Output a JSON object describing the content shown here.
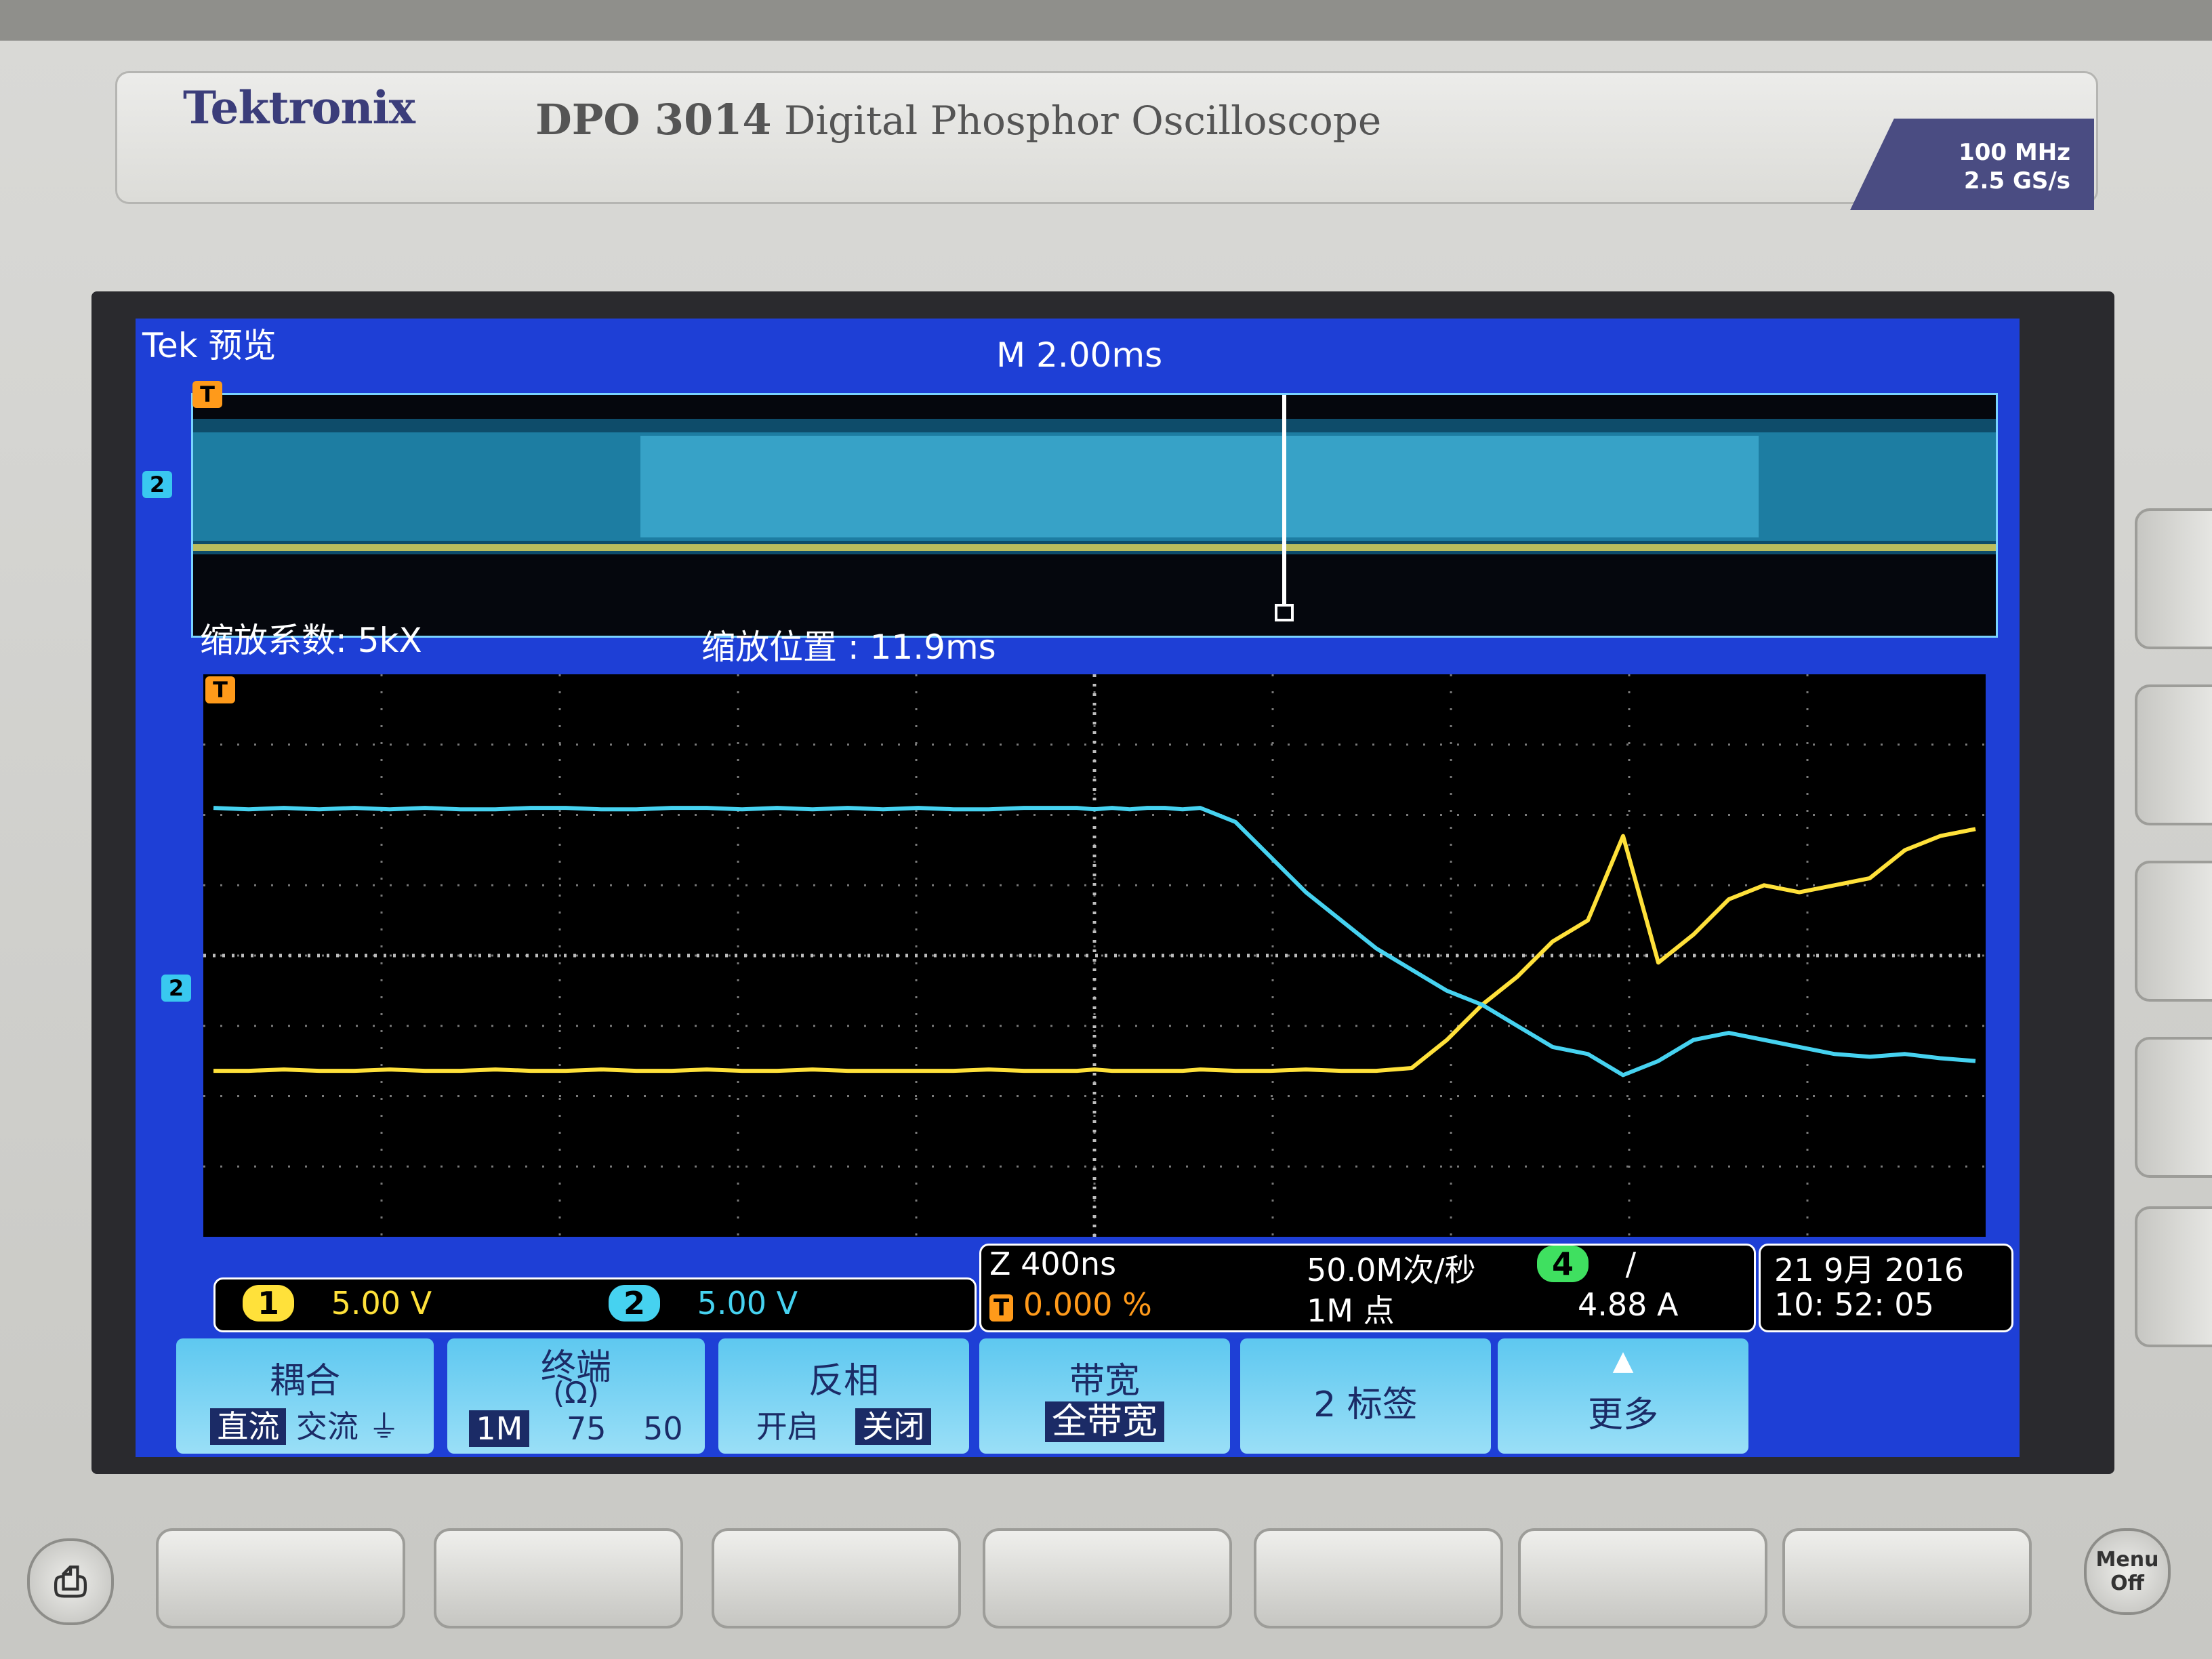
{
  "instrument": {
    "brand": "Tektronix",
    "model": "DPO 3014",
    "description": "Digital Phosphor Oscilloscope",
    "bandwidth": "100 MHz",
    "sample_rate": "2.5 GS/s"
  },
  "screen_header": {
    "brand_mark": "Tek",
    "mode": "预览",
    "timebase": "M 2.00ms"
  },
  "zoom_info": {
    "factor": "缩放系数: 5kX",
    "position": "缩放位置 :  11.9ms"
  },
  "markers": {
    "trigger": "T",
    "ch2": "2"
  },
  "status": {
    "ch1_num": "1",
    "ch1_scale": "5.00 V",
    "ch2_num": "2",
    "ch2_scale": "5.00 V",
    "zoom_timebase": "Z 400ns",
    "trigger_pos": "0.000 %",
    "sample_rate": "50.0M次/秒",
    "record_length": "1M 点",
    "trig_source": "4",
    "trig_slope": "/",
    "trig_level": "4.88 A",
    "date": "21 9月    2016",
    "time": "10: 52: 05"
  },
  "menu": {
    "coupling": {
      "label": "耦合",
      "opt_dc": "直流",
      "opt_ac": "交流",
      "opt_gnd": "⏚"
    },
    "termination": {
      "label": "终端",
      "unit": "(Ω)",
      "opt_1m": "1M",
      "opt_75": "75",
      "opt_50": "50"
    },
    "invert": {
      "label": "反相",
      "opt_on": "开启",
      "opt_off": "关闭"
    },
    "bandwidth": {
      "label": "带宽",
      "value": "全带宽"
    },
    "label_btn": {
      "label": "2  标签"
    },
    "more": {
      "label": "更多"
    }
  },
  "front_panel": {
    "menu_off": "Menu Off"
  },
  "colors": {
    "ch1": "#ffe13a",
    "ch2": "#46d2f0",
    "screen_bg": "#1e3fd6",
    "trigger": "#ff9a1a"
  },
  "chart_data": {
    "type": "line",
    "x_unit": "ns",
    "x": [
      0,
      160,
      320,
      480,
      640,
      800,
      960,
      1120,
      1280,
      1440,
      1600,
      1760,
      1920,
      2080,
      2240,
      2400,
      2560,
      2720,
      2880,
      3040,
      3200,
      3360,
      3520,
      3680,
      3840,
      3920,
      4000,
      4080,
      4160,
      4240,
      4320,
      4400,
      4480,
      4640,
      4800,
      4960,
      5120,
      5280,
      5440,
      5600,
      5760,
      5920,
      6080,
      6240,
      6400,
      6560,
      6720,
      6880,
      7040,
      7200,
      7360,
      7520,
      7680,
      7840,
      8000
    ],
    "series": [
      {
        "name": "1",
        "unit": "V",
        "values": [
          -8.2,
          -8.2,
          -8.1,
          -8.2,
          -8.2,
          -8.1,
          -8.2,
          -8.2,
          -8.1,
          -8.2,
          -8.2,
          -8.1,
          -8.2,
          -8.2,
          -8.1,
          -8.2,
          -8.2,
          -8.1,
          -8.2,
          -8.2,
          -8.2,
          -8.2,
          -8.1,
          -8.2,
          -8.2,
          -8.2,
          -8.1,
          -8.2,
          -8.2,
          -8.2,
          -8.2,
          -8.2,
          -8.1,
          -8.2,
          -8.2,
          -8.1,
          -8.2,
          -8.2,
          -8.0,
          -6.0,
          -3.5,
          -1.5,
          1.0,
          2.5,
          8.5,
          -0.5,
          1.5,
          4.0,
          5.0,
          4.5,
          5.0,
          5.5,
          7.5,
          8.5,
          9.0
        ]
      },
      {
        "name": "2",
        "unit": "V",
        "values": [
          10.5,
          10.4,
          10.5,
          10.4,
          10.5,
          10.4,
          10.5,
          10.4,
          10.4,
          10.5,
          10.5,
          10.4,
          10.4,
          10.5,
          10.5,
          10.4,
          10.5,
          10.4,
          10.5,
          10.4,
          10.5,
          10.4,
          10.4,
          10.5,
          10.5,
          10.5,
          10.4,
          10.5,
          10.4,
          10.5,
          10.5,
          10.4,
          10.5,
          9.5,
          7.0,
          4.5,
          2.5,
          0.5,
          -1.0,
          -2.5,
          -3.5,
          -5.0,
          -6.5,
          -7.0,
          -8.5,
          -7.5,
          -6.0,
          -5.5,
          -6.0,
          -6.5,
          -7.0,
          -7.2,
          -7.0,
          -7.3,
          -7.5
        ]
      }
    ],
    "divisions_x": 10,
    "divisions_y": 8,
    "ch2_offset_div": 0,
    "ch1_offset_div": 0,
    "grid": true
  }
}
